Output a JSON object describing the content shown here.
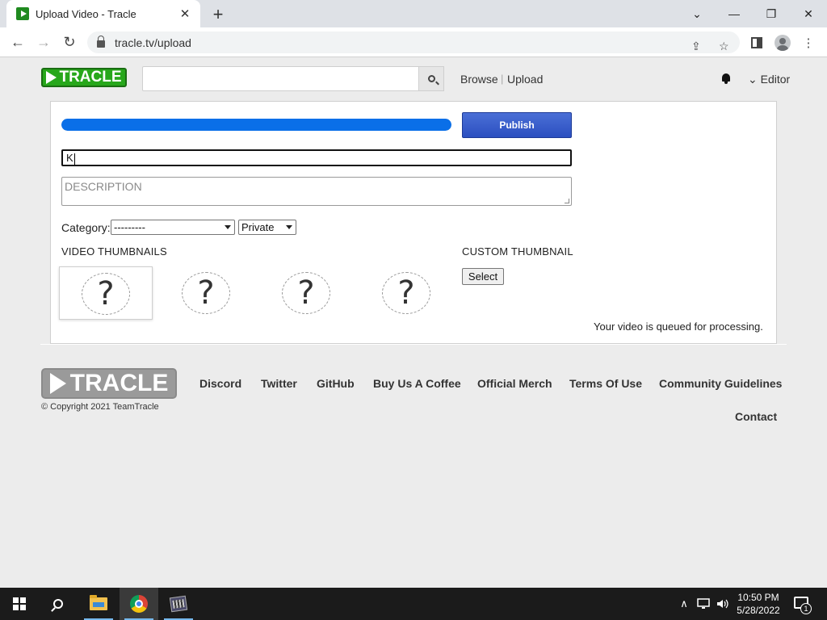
{
  "browser": {
    "tab_title": "Upload Video - Tracle",
    "tab_close": "✕",
    "new_tab": "+",
    "url": "tracle.tv/upload",
    "window_controls": {
      "chevron": "⌄",
      "minimize": "—",
      "restore": "❐",
      "close": "✕"
    }
  },
  "site": {
    "logo_text": "TRACLE",
    "search": {
      "value": "",
      "placeholder": ""
    },
    "nav": {
      "browse": "Browse",
      "separator": "|",
      "upload": "Upload"
    },
    "editor_menu": "Editor",
    "editor_chevron": "⌄"
  },
  "upload": {
    "progress_percent": 100,
    "progress_color": "#0a6fe8",
    "publish_label": "Publish",
    "title_value": "K",
    "description_placeholder": "DESCRIPTION",
    "category_label": "Category:",
    "category_selected": "---------",
    "privacy_selected": "Private",
    "video_thumbnails_heading": "VIDEO THUMBNAILS",
    "custom_thumbnail_heading": "CUSTOM THUMBNAIL",
    "thumbnail_placeholder": "?",
    "select_label": "Select",
    "status": "Your video is queued for processing."
  },
  "footer": {
    "logo_text": "TRACLE",
    "copyright": "© Copyright 2021 TeamTracle",
    "links": [
      "Discord",
      "Twitter",
      "GitHub",
      "Buy Us A Coffee",
      "Official Merch",
      "Terms Of Use",
      "Community Guidelines"
    ],
    "contact": "Contact"
  },
  "taskbar": {
    "time": "10:50 PM",
    "date": "5/28/2022",
    "notification_count": "1",
    "tray_chevron": "∧"
  }
}
